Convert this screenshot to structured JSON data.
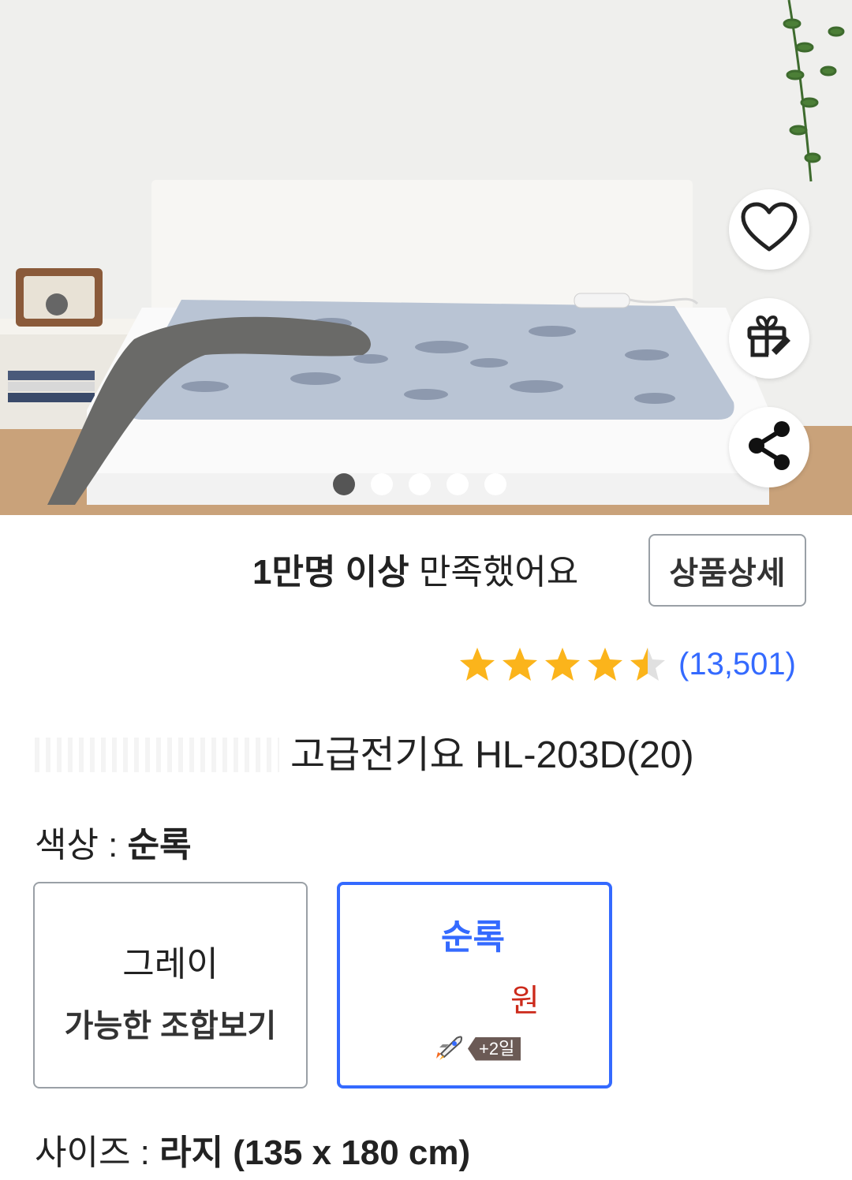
{
  "hero": {
    "icons": {
      "wishlist": "heart-icon",
      "gift": "gift-icon",
      "share": "share-icon"
    },
    "carousel": {
      "total": 5,
      "active_index": 0
    }
  },
  "summary": {
    "satisfaction_bold": "1만명 이상",
    "satisfaction_text": "만족했어요",
    "detail_button": "상품상세"
  },
  "rating": {
    "value_stars": 4.5,
    "max_stars": 5,
    "review_count": "(13,501)",
    "star_color": "#fbb41b"
  },
  "product": {
    "title": "고급전기요 HL-203D(20)"
  },
  "color_option": {
    "label": "색상 : ",
    "selected": "순록",
    "cards": [
      {
        "name": "그레이",
        "subtext": "가능한 조합보기"
      },
      {
        "name": "순록",
        "price_unit": "원",
        "delivery_badge": "+2일",
        "delivery_icon": "rocket-icon"
      }
    ],
    "accent_color": "#346aff",
    "price_color": "#cc2a1b"
  },
  "size_option": {
    "label": "사이즈 : ",
    "selected": "라지 (135 x 180 cm)"
  }
}
